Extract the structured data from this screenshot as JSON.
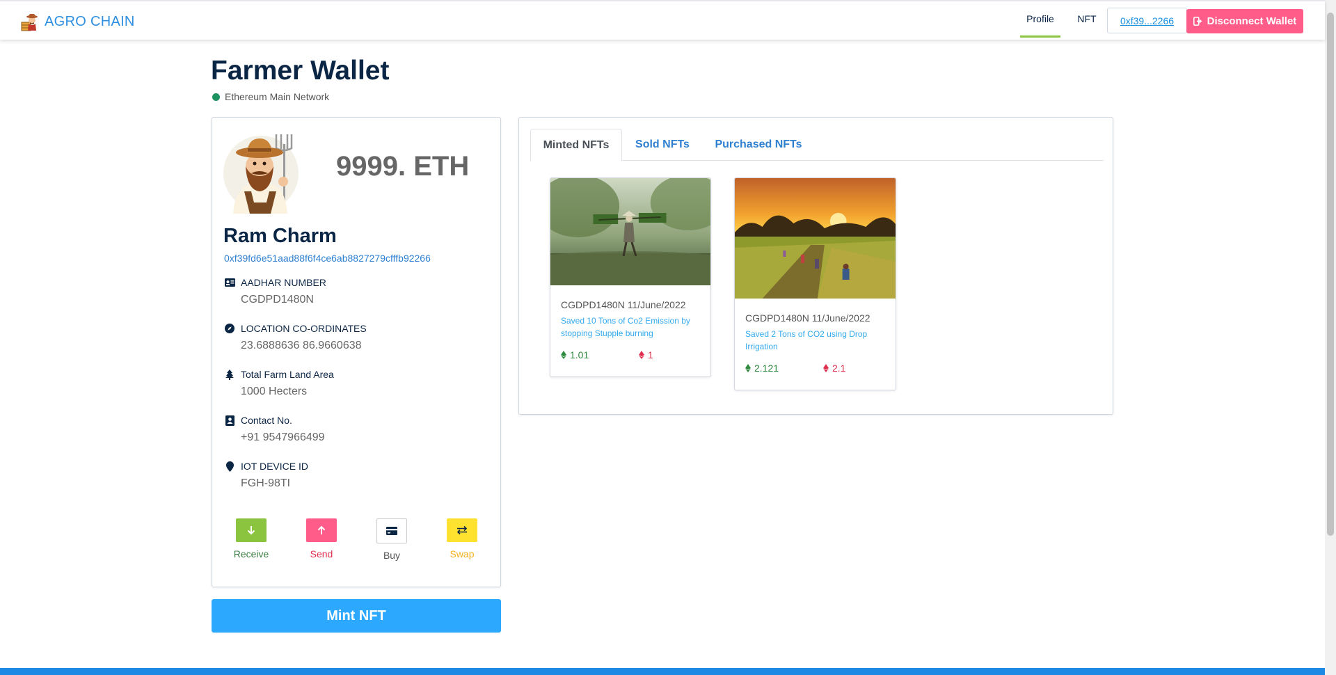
{
  "navbar": {
    "brand": "AGRO CHAIN",
    "links": [
      {
        "label": "Profile",
        "active": true
      },
      {
        "label": "NFT",
        "active": false
      }
    ],
    "wallet_short": "0xf39...2266",
    "disconnect_label": "Disconnect Wallet",
    "active_underline_color": "#8bc53f"
  },
  "page": {
    "title": "Farmer Wallet",
    "network": "Ethereum Main Network",
    "network_status_color": "#1e9361"
  },
  "profile": {
    "balance": "9999. ETH",
    "name": "Ram Charm",
    "address": "0xf39fd6e51aad88f6f4ce6ab8827279cfffb92266",
    "fields": [
      {
        "icon": "id-card-icon",
        "label": "AADHAR NUMBER",
        "value": "CGDPD1480N"
      },
      {
        "icon": "compass-icon",
        "label": "LOCATION CO-ORDINATES",
        "value": "23.6888636 86.9660638"
      },
      {
        "icon": "tree-icon",
        "label": "Total Farm Land Area",
        "value": "1000 Hecters"
      },
      {
        "icon": "contact-icon",
        "label": "Contact No.",
        "value": "+91 9547966499"
      },
      {
        "icon": "map-pin-icon",
        "label": "IOT DEVICE ID",
        "value": "FGH-98TI"
      }
    ],
    "actions": [
      {
        "label": "Receive",
        "icon": "arrow-down-icon",
        "color": "#8bc53f"
      },
      {
        "label": "Send",
        "icon": "arrow-up-icon",
        "color": "#ff5c8a"
      },
      {
        "label": "Buy",
        "icon": "credit-card-icon",
        "color": "#ffffff"
      },
      {
        "label": "Swap",
        "icon": "swap-arrows-icon",
        "color": "#ffe130"
      }
    ]
  },
  "mint_label": "Mint NFT",
  "nft_panel": {
    "tabs": [
      {
        "label": "Minted NFTs",
        "active": true
      },
      {
        "label": "Sold NFTs",
        "active": false
      },
      {
        "label": "Purchased NFTs",
        "active": false
      }
    ],
    "cards": [
      {
        "image": "farmer-carrying-rice-seedlings-photo",
        "meta": "CGDPD1480N 11/June/2022",
        "description": "Saved 10 Tons of Co2 Emission by stopping Stupple burning",
        "price_a": "1.01",
        "price_b": "1"
      },
      {
        "image": "rice-field-sunset-photo",
        "meta": "CGDPD1480N 11/June/2022",
        "description": "Saved 2 Tons of CO2 using Drop Irrigation",
        "price_a": "2.121",
        "price_b": "2.1"
      }
    ]
  },
  "colors": {
    "brand": "#2f8fe0",
    "primary_button": "#2da8ff",
    "danger_button": "#ff5c8a",
    "footer": "#1e88e5"
  }
}
